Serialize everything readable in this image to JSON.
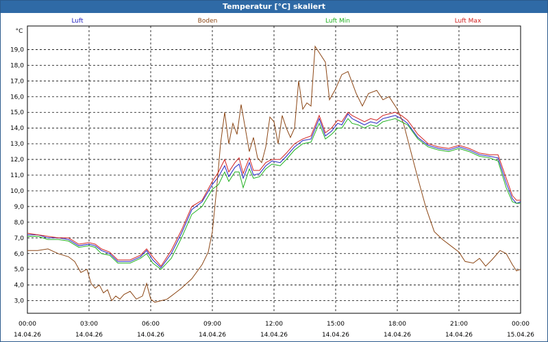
{
  "window": {
    "title": "Temperatur [°C] skaliert"
  },
  "colors": {
    "background": "#ffffff",
    "titlebar": "#2f6aa6",
    "grid": "#000000"
  },
  "chart_data": {
    "type": "line",
    "title": "Temperatur [°C] skaliert",
    "ylabel": "°C",
    "xlabel": "",
    "ylim": [
      2.2,
      20.5
    ],
    "xlim": [
      0,
      24
    ],
    "grid": true,
    "legend": "top",
    "yticks": [
      "3,0",
      "4,0",
      "5,0",
      "6,0",
      "7,0",
      "8,0",
      "9,0",
      "10,0",
      "11,0",
      "12,0",
      "13,0",
      "14,0",
      "15,0",
      "16,0",
      "17,0",
      "18,0",
      "19,0"
    ],
    "xticks": [
      {
        "time": "00:00",
        "date": "14.04.26"
      },
      {
        "time": "03:00",
        "date": "14.04.26"
      },
      {
        "time": "06:00",
        "date": "14.04.26"
      },
      {
        "time": "09:00",
        "date": "14.04.26"
      },
      {
        "time": "12:00",
        "date": "14.04.26"
      },
      {
        "time": "15:00",
        "date": "14.04.26"
      },
      {
        "time": "18:00",
        "date": "14.04.26"
      },
      {
        "time": "21:00",
        "date": "14.04.26"
      },
      {
        "time": "00:00",
        "date": "15.04.26"
      }
    ],
    "series": [
      {
        "name": "Luft",
        "color": "#2020c0",
        "points": [
          [
            0,
            7.2
          ],
          [
            0.5,
            7.2
          ],
          [
            1,
            7.0
          ],
          [
            1.5,
            7.0
          ],
          [
            2,
            6.9
          ],
          [
            2.5,
            6.5
          ],
          [
            3,
            6.6
          ],
          [
            3.3,
            6.5
          ],
          [
            3.6,
            6.2
          ],
          [
            4,
            6.0
          ],
          [
            4.4,
            5.5
          ],
          [
            4.7,
            5.5
          ],
          [
            5,
            5.5
          ],
          [
            5.5,
            5.8
          ],
          [
            5.8,
            6.2
          ],
          [
            6.1,
            5.6
          ],
          [
            6.5,
            5.1
          ],
          [
            7,
            6.0
          ],
          [
            7.5,
            7.3
          ],
          [
            8,
            8.8
          ],
          [
            8.5,
            9.3
          ],
          [
            9,
            10.4
          ],
          [
            9.3,
            10.9
          ],
          [
            9.6,
            11.6
          ],
          [
            9.8,
            10.9
          ],
          [
            10.1,
            11.5
          ],
          [
            10.3,
            11.7
          ],
          [
            10.5,
            10.8
          ],
          [
            10.8,
            11.8
          ],
          [
            11,
            11.0
          ],
          [
            11.3,
            11.1
          ],
          [
            11.6,
            11.6
          ],
          [
            11.9,
            11.9
          ],
          [
            12.3,
            11.8
          ],
          [
            12.6,
            12.2
          ],
          [
            13,
            12.8
          ],
          [
            13.4,
            13.2
          ],
          [
            13.8,
            13.3
          ],
          [
            14.2,
            14.6
          ],
          [
            14.5,
            13.5
          ],
          [
            14.8,
            13.8
          ],
          [
            15.1,
            14.3
          ],
          [
            15.3,
            14.2
          ],
          [
            15.6,
            14.9
          ],
          [
            15.8,
            14.6
          ],
          [
            16.1,
            14.4
          ],
          [
            16.4,
            14.2
          ],
          [
            16.7,
            14.4
          ],
          [
            17,
            14.3
          ],
          [
            17.3,
            14.6
          ],
          [
            17.6,
            14.7
          ],
          [
            17.9,
            14.8
          ],
          [
            18.2,
            14.6
          ],
          [
            18.5,
            14.3
          ],
          [
            19,
            13.4
          ],
          [
            19.5,
            12.9
          ],
          [
            20,
            12.7
          ],
          [
            20.5,
            12.6
          ],
          [
            21,
            12.8
          ],
          [
            21.5,
            12.6
          ],
          [
            22,
            12.3
          ],
          [
            22.5,
            12.2
          ],
          [
            22.9,
            12.1
          ],
          [
            23.3,
            10.5
          ],
          [
            23.6,
            9.5
          ],
          [
            23.8,
            9.2
          ],
          [
            24,
            9.3
          ]
        ]
      },
      {
        "name": "Boden",
        "color": "#8b4513",
        "points": [
          [
            0,
            6.2
          ],
          [
            0.5,
            6.2
          ],
          [
            1,
            6.3
          ],
          [
            1.5,
            6.0
          ],
          [
            2,
            5.8
          ],
          [
            2.3,
            5.5
          ],
          [
            2.6,
            4.8
          ],
          [
            2.9,
            5.0
          ],
          [
            3.1,
            4.1
          ],
          [
            3.3,
            3.8
          ],
          [
            3.5,
            4.0
          ],
          [
            3.7,
            3.5
          ],
          [
            3.9,
            3.7
          ],
          [
            4.1,
            3.0
          ],
          [
            4.3,
            3.3
          ],
          [
            4.5,
            3.1
          ],
          [
            4.7,
            3.4
          ],
          [
            5,
            3.6
          ],
          [
            5.3,
            3.1
          ],
          [
            5.6,
            3.3
          ],
          [
            5.8,
            4.1
          ],
          [
            6,
            3.1
          ],
          [
            6.2,
            2.9
          ],
          [
            6.5,
            3.0
          ],
          [
            6.8,
            3.1
          ],
          [
            7,
            3.3
          ],
          [
            7.5,
            3.8
          ],
          [
            8,
            4.4
          ],
          [
            8.5,
            5.3
          ],
          [
            8.8,
            6.1
          ],
          [
            9,
            7.4
          ],
          [
            9.2,
            10.0
          ],
          [
            9.4,
            13.0
          ],
          [
            9.6,
            15.0
          ],
          [
            9.8,
            13.0
          ],
          [
            10,
            14.3
          ],
          [
            10.2,
            13.6
          ],
          [
            10.4,
            15.5
          ],
          [
            10.6,
            14.0
          ],
          [
            10.8,
            12.5
          ],
          [
            11,
            13.4
          ],
          [
            11.2,
            12.1
          ],
          [
            11.4,
            11.8
          ],
          [
            11.6,
            12.8
          ],
          [
            11.8,
            14.7
          ],
          [
            12,
            14.4
          ],
          [
            12.2,
            13.0
          ],
          [
            12.4,
            14.8
          ],
          [
            12.6,
            14.0
          ],
          [
            12.8,
            13.4
          ],
          [
            13,
            14.0
          ],
          [
            13.2,
            17.0
          ],
          [
            13.4,
            15.2
          ],
          [
            13.6,
            15.6
          ],
          [
            13.8,
            15.4
          ],
          [
            14,
            19.2
          ],
          [
            14.2,
            18.8
          ],
          [
            14.5,
            18.2
          ],
          [
            14.7,
            15.8
          ],
          [
            15,
            16.5
          ],
          [
            15.3,
            17.4
          ],
          [
            15.6,
            17.6
          ],
          [
            16,
            16.2
          ],
          [
            16.3,
            15.4
          ],
          [
            16.6,
            16.2
          ],
          [
            17,
            16.4
          ],
          [
            17.3,
            15.8
          ],
          [
            17.6,
            16.0
          ],
          [
            18,
            15.2
          ],
          [
            18.3,
            14.3
          ],
          [
            18.6,
            12.8
          ],
          [
            19,
            10.8
          ],
          [
            19.4,
            8.9
          ],
          [
            19.8,
            7.4
          ],
          [
            20.2,
            6.9
          ],
          [
            20.6,
            6.5
          ],
          [
            21,
            6.1
          ],
          [
            21.3,
            5.5
          ],
          [
            21.7,
            5.4
          ],
          [
            22,
            5.7
          ],
          [
            22.3,
            5.2
          ],
          [
            22.6,
            5.6
          ],
          [
            23,
            6.2
          ],
          [
            23.3,
            6.0
          ],
          [
            23.6,
            5.3
          ],
          [
            23.8,
            4.9
          ],
          [
            24,
            5.0
          ]
        ]
      },
      {
        "name": "Luft Min",
        "color": "#20b020",
        "points": [
          [
            0,
            7.1
          ],
          [
            0.5,
            7.1
          ],
          [
            1,
            6.9
          ],
          [
            1.5,
            6.9
          ],
          [
            2,
            6.8
          ],
          [
            2.5,
            6.4
          ],
          [
            3,
            6.5
          ],
          [
            3.3,
            6.4
          ],
          [
            3.6,
            6.0
          ],
          [
            4,
            5.9
          ],
          [
            4.4,
            5.4
          ],
          [
            4.7,
            5.4
          ],
          [
            5,
            5.4
          ],
          [
            5.5,
            5.7
          ],
          [
            5.8,
            6.0
          ],
          [
            6.1,
            5.4
          ],
          [
            6.5,
            5.0
          ],
          [
            7,
            5.7
          ],
          [
            7.5,
            7.0
          ],
          [
            8,
            8.5
          ],
          [
            8.5,
            9.0
          ],
          [
            9,
            10.1
          ],
          [
            9.3,
            10.4
          ],
          [
            9.6,
            11.2
          ],
          [
            9.8,
            10.6
          ],
          [
            10.1,
            11.2
          ],
          [
            10.3,
            11.2
          ],
          [
            10.5,
            10.2
          ],
          [
            10.8,
            11.4
          ],
          [
            11,
            10.8
          ],
          [
            11.3,
            10.9
          ],
          [
            11.6,
            11.4
          ],
          [
            11.9,
            11.7
          ],
          [
            12.3,
            11.6
          ],
          [
            12.6,
            12.0
          ],
          [
            13,
            12.6
          ],
          [
            13.4,
            13.0
          ],
          [
            13.8,
            13.1
          ],
          [
            14.2,
            14.3
          ],
          [
            14.5,
            13.3
          ],
          [
            14.8,
            13.6
          ],
          [
            15.1,
            14.0
          ],
          [
            15.3,
            14.0
          ],
          [
            15.6,
            14.6
          ],
          [
            15.8,
            14.3
          ],
          [
            16.1,
            14.2
          ],
          [
            16.4,
            14.0
          ],
          [
            16.7,
            14.2
          ],
          [
            17,
            14.1
          ],
          [
            17.3,
            14.4
          ],
          [
            17.6,
            14.5
          ],
          [
            17.9,
            14.6
          ],
          [
            18.2,
            14.4
          ],
          [
            18.5,
            14.2
          ],
          [
            19,
            13.3
          ],
          [
            19.5,
            12.8
          ],
          [
            20,
            12.6
          ],
          [
            20.5,
            12.5
          ],
          [
            21,
            12.7
          ],
          [
            21.5,
            12.5
          ],
          [
            22,
            12.2
          ],
          [
            22.5,
            12.1
          ],
          [
            22.9,
            11.9
          ],
          [
            23.3,
            10.2
          ],
          [
            23.6,
            9.3
          ],
          [
            23.8,
            9.2
          ],
          [
            24,
            9.2
          ]
        ]
      },
      {
        "name": "Luft Max",
        "color": "#d02020",
        "points": [
          [
            0,
            7.3
          ],
          [
            0.5,
            7.2
          ],
          [
            1,
            7.1
          ],
          [
            1.5,
            7.0
          ],
          [
            2,
            7.0
          ],
          [
            2.5,
            6.6
          ],
          [
            3,
            6.7
          ],
          [
            3.3,
            6.6
          ],
          [
            3.6,
            6.3
          ],
          [
            4,
            6.1
          ],
          [
            4.4,
            5.6
          ],
          [
            4.7,
            5.6
          ],
          [
            5,
            5.6
          ],
          [
            5.5,
            5.9
          ],
          [
            5.8,
            6.3
          ],
          [
            6.1,
            5.8
          ],
          [
            6.5,
            5.2
          ],
          [
            7,
            6.2
          ],
          [
            7.5,
            7.5
          ],
          [
            8,
            9.0
          ],
          [
            8.5,
            9.4
          ],
          [
            9,
            10.6
          ],
          [
            9.3,
            11.2
          ],
          [
            9.6,
            12.0
          ],
          [
            9.8,
            11.2
          ],
          [
            10.1,
            11.8
          ],
          [
            10.3,
            12.1
          ],
          [
            10.5,
            11.1
          ],
          [
            10.8,
            12.1
          ],
          [
            11,
            11.3
          ],
          [
            11.3,
            11.3
          ],
          [
            11.6,
            11.8
          ],
          [
            11.9,
            12.0
          ],
          [
            12.3,
            12.0
          ],
          [
            12.6,
            12.4
          ],
          [
            13,
            13.0
          ],
          [
            13.4,
            13.3
          ],
          [
            13.8,
            13.5
          ],
          [
            14.2,
            14.8
          ],
          [
            14.5,
            13.7
          ],
          [
            14.8,
            14.0
          ],
          [
            15.1,
            14.5
          ],
          [
            15.3,
            14.4
          ],
          [
            15.6,
            15.0
          ],
          [
            15.8,
            14.8
          ],
          [
            16.1,
            14.6
          ],
          [
            16.4,
            14.4
          ],
          [
            16.7,
            14.6
          ],
          [
            17,
            14.5
          ],
          [
            17.3,
            14.8
          ],
          [
            17.6,
            14.9
          ],
          [
            17.9,
            15.0
          ],
          [
            18.2,
            14.8
          ],
          [
            18.5,
            14.5
          ],
          [
            19,
            13.6
          ],
          [
            19.5,
            13.0
          ],
          [
            20,
            12.8
          ],
          [
            20.5,
            12.7
          ],
          [
            21,
            12.9
          ],
          [
            21.5,
            12.7
          ],
          [
            22,
            12.4
          ],
          [
            22.5,
            12.3
          ],
          [
            22.9,
            12.3
          ],
          [
            23.3,
            10.8
          ],
          [
            23.6,
            9.7
          ],
          [
            23.8,
            9.4
          ],
          [
            24,
            9.4
          ]
        ]
      }
    ]
  }
}
